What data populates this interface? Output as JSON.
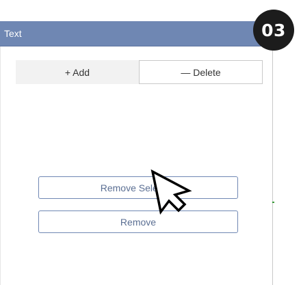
{
  "panel": {
    "title": "Text"
  },
  "tabs": {
    "add_label": "+ Add",
    "delete_label": "— Delete"
  },
  "actions": {
    "remove_selected_label": "Remove Selected",
    "remove_label": "Remove"
  },
  "badge": {
    "step": "03"
  },
  "colors": {
    "header": "#6f87b3",
    "button_border": "#6f87b3",
    "badge": "#1c1c1c"
  },
  "icons": {
    "cursor": "arrow-cursor-icon"
  }
}
